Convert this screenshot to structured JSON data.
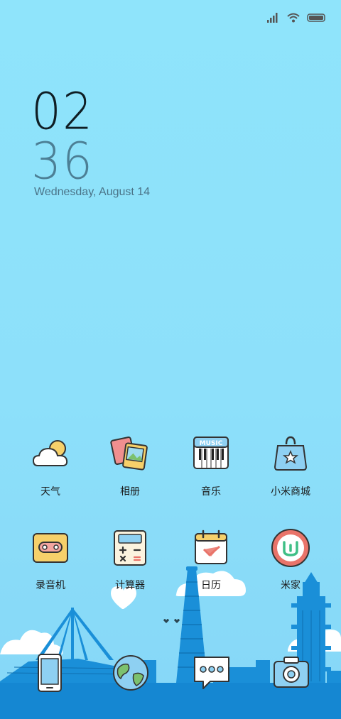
{
  "status_bar": {
    "icons": [
      "signal-icon",
      "wifi-icon",
      "battery-icon"
    ]
  },
  "clock": {
    "hours": "02",
    "minutes": "36"
  },
  "date": "Wednesday, August 14",
  "apps": [
    {
      "label": "天气",
      "icon": "weather-icon"
    },
    {
      "label": "相册",
      "icon": "gallery-icon"
    },
    {
      "label": "音乐",
      "icon": "music-icon"
    },
    {
      "label": "小米商城",
      "icon": "mi-store-icon"
    },
    {
      "label": "录音机",
      "icon": "recorder-icon"
    },
    {
      "label": "计算器",
      "icon": "calculator-icon"
    },
    {
      "label": "日历",
      "icon": "calendar-icon"
    },
    {
      "label": "米家",
      "icon": "mi-home-icon"
    }
  ],
  "music_icon_text": "MUSIC",
  "dock": [
    {
      "icon": "phone-icon"
    },
    {
      "icon": "browser-globe-icon"
    },
    {
      "icon": "messages-icon"
    },
    {
      "icon": "camera-icon"
    }
  ],
  "colors": {
    "sky": "#8de0fa",
    "building": "#1a8fd8",
    "ground": "#1587d2"
  }
}
